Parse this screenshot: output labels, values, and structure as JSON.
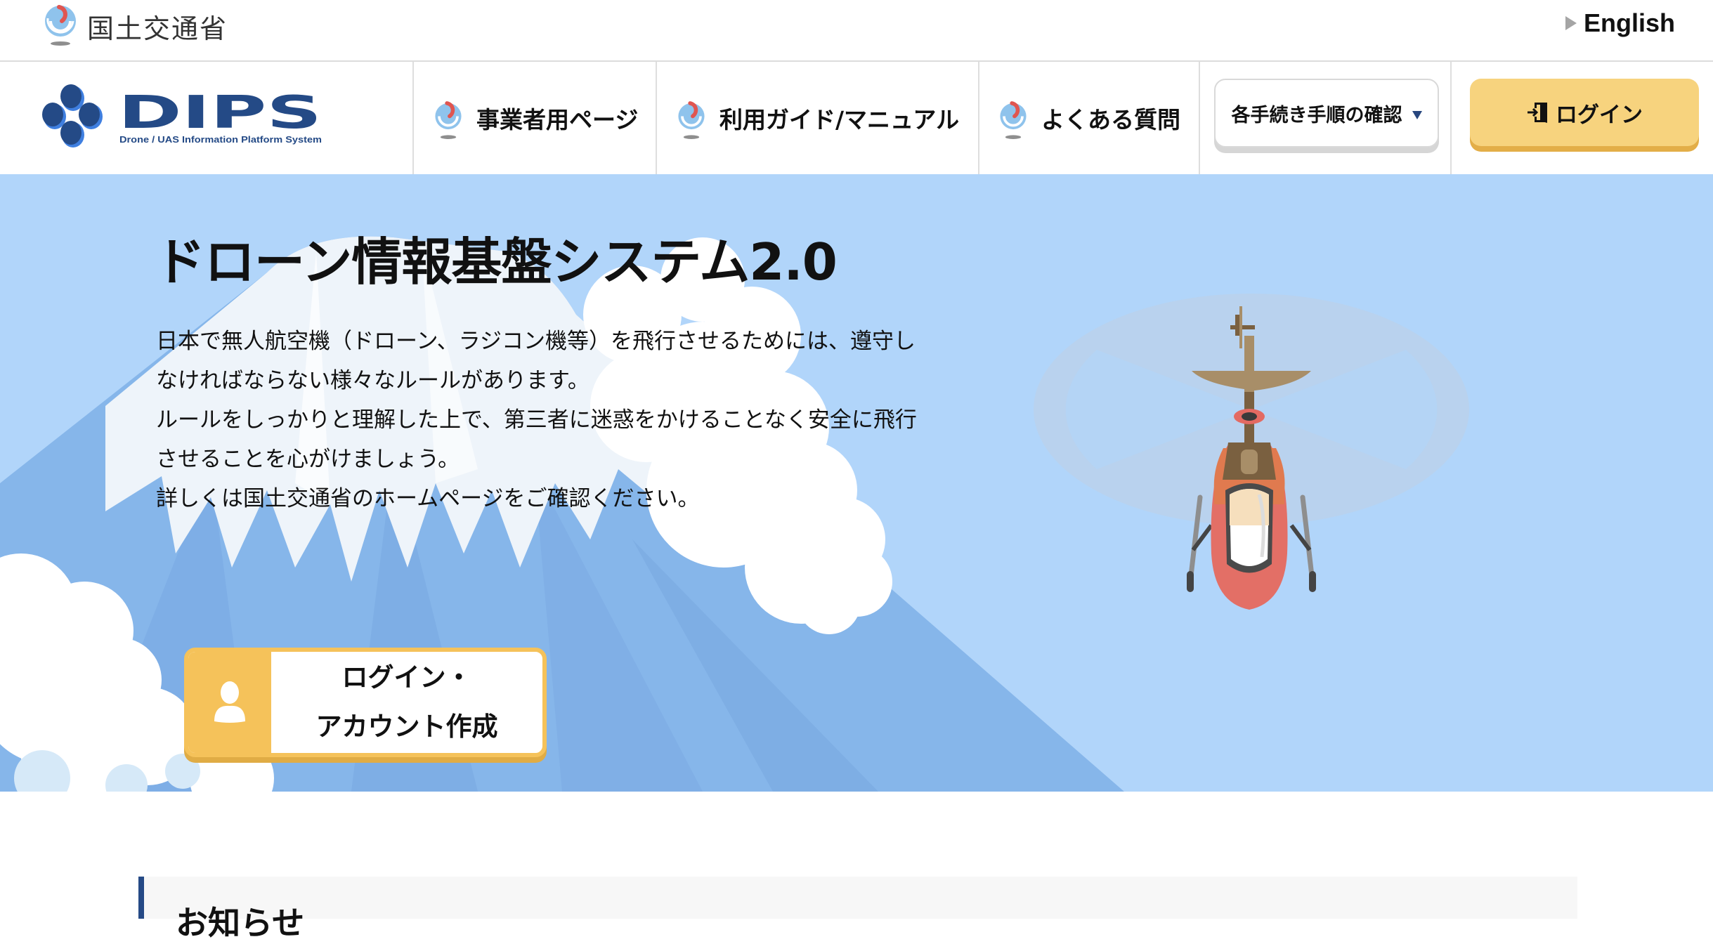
{
  "header": {
    "ministry_name": "国土交通省",
    "language_link": "English"
  },
  "nav": {
    "logo": {
      "wordmark": "DIPS",
      "tagline": "Drone / UAS Information Platform System"
    },
    "items": [
      {
        "label": "事業者用ページ",
        "icon": "mlit-emblem-icon"
      },
      {
        "label": "利用ガイド/マニュアル",
        "icon": "mlit-emblem-icon"
      },
      {
        "label": "よくある質問",
        "icon": "mlit-emblem-icon"
      }
    ],
    "procedures_dropdown": {
      "label": "各手続き手順の確認",
      "icon": "caret-down-icon"
    },
    "login_button": {
      "label": "ログイン",
      "icon": "login-door-icon"
    }
  },
  "hero": {
    "title": "ドローン情報基盤システム2.0",
    "paragraph_lines": [
      "日本で無人航空機（ドローン、ラジコン機等）を飛行させるためには、遵守し",
      "なければならない様々なルールがあります。",
      "ルールをしっかりと理解した上で、第三者に迷惑をかけることなく安全に飛行",
      "させることを心がけましょう。",
      "詳しくは国土交通省のホームページをご確認ください。"
    ],
    "account_button": {
      "line1": "ログイン・",
      "line2": "アカウント作成",
      "icon": "user-icon"
    }
  },
  "notice": {
    "heading": "お知らせ"
  },
  "colors": {
    "hero_sky": "#b1d5fa",
    "accent_yellow": "#f5c25a",
    "login_yellow": "#f7d37e",
    "brand_navy": "#264a86"
  }
}
